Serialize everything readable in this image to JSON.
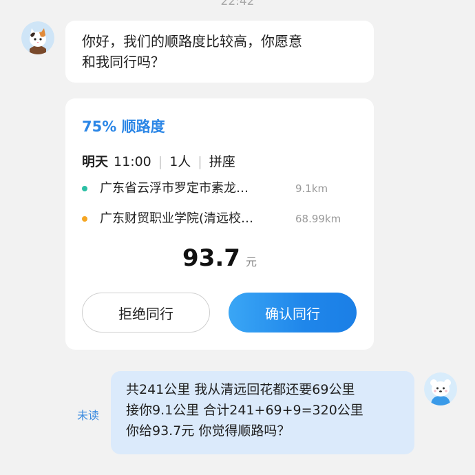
{
  "chat": {
    "time": "22:42",
    "incoming_message": {
      "text_line1": "你好，我们的顺路度比较高，你愿意",
      "text_line2": "和我同行吗？"
    },
    "trip_card": {
      "match_label": "75% 顺路度",
      "date": "明天",
      "time": "11:00",
      "passengers": "1人",
      "ride_type": "拼座",
      "stops": [
        {
          "name": "广东省云浮市罗定市素龙…",
          "distance": "9.1km",
          "color": "#2bbfa4"
        },
        {
          "name": "广东财贸职业学院(清远校…",
          "distance": "68.99km",
          "color": "#f5a623"
        }
      ],
      "price": "93.7",
      "price_unit": "元",
      "reject_label": "拒绝同行",
      "confirm_label": "确认同行"
    },
    "outgoing_message": {
      "status": "未读",
      "lines": [
        "共241公里 我从清远回花都还要69公里",
        "接你9.1公里  合计241+69+9=320公里",
        "你给93.7元 你觉得顺路吗？"
      ]
    }
  },
  "icons": {
    "incoming_avatar": "calico-cat-avatar",
    "outgoing_avatar": "white-bear-avatar"
  },
  "colors": {
    "accent_blue": "#2b86e6",
    "outgoing_bubble": "#dbeafb",
    "unread_text": "#3b8be0"
  }
}
